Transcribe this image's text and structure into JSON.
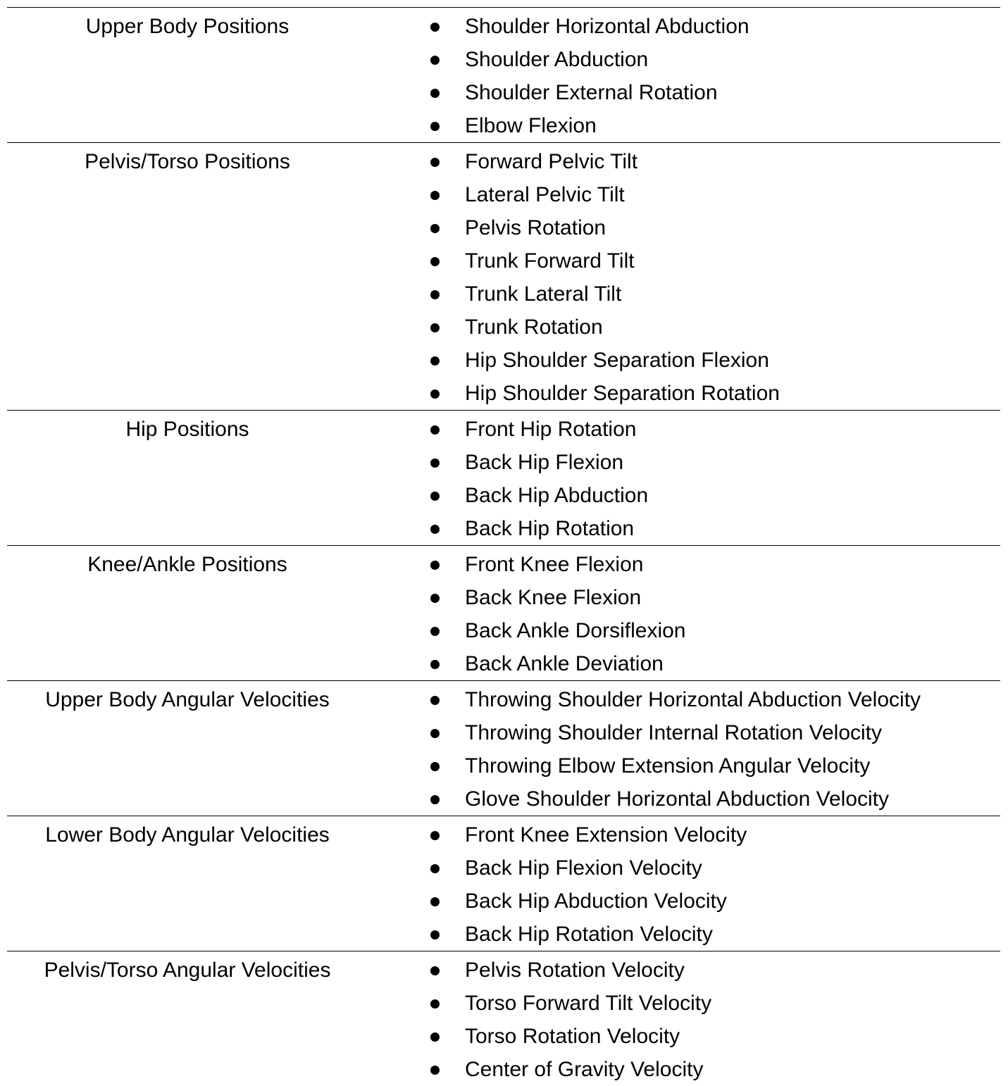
{
  "rows": [
    {
      "category": "Upper Body Positions",
      "items": [
        "Shoulder Horizontal Abduction",
        "Shoulder Abduction",
        "Shoulder External Rotation",
        "Elbow Flexion"
      ]
    },
    {
      "category": "Pelvis/Torso Positions",
      "items": [
        "Forward Pelvic Tilt",
        "Lateral Pelvic Tilt",
        "Pelvis Rotation",
        "Trunk Forward Tilt",
        "Trunk Lateral Tilt",
        "Trunk Rotation",
        "Hip Shoulder Separation Flexion",
        "Hip Shoulder Separation Rotation"
      ]
    },
    {
      "category": "Hip Positions",
      "items": [
        "Front Hip Rotation",
        "Back Hip Flexion",
        "Back Hip Abduction",
        "Back Hip Rotation"
      ]
    },
    {
      "category": "Knee/Ankle Positions",
      "items": [
        "Front Knee Flexion",
        "Back Knee Flexion",
        "Back Ankle Dorsiflexion",
        "Back Ankle Deviation"
      ]
    },
    {
      "category": "Upper Body Angular Velocities",
      "items": [
        "Throwing Shoulder Horizontal Abduction Velocity",
        "Throwing Shoulder Internal Rotation Velocity",
        "Throwing Elbow Extension Angular Velocity",
        "Glove Shoulder Horizontal Abduction Velocity"
      ]
    },
    {
      "category": "Lower Body Angular Velocities",
      "items": [
        "Front Knee Extension Velocity",
        "Back Hip Flexion Velocity",
        "Back Hip Abduction Velocity",
        "Back Hip Rotation Velocity"
      ]
    },
    {
      "category": "Pelvis/Torso Angular Velocities",
      "items": [
        "Pelvis Rotation Velocity",
        "Torso Forward Tilt Velocity",
        "Torso Rotation Velocity",
        "Center of Gravity Velocity"
      ]
    }
  ]
}
